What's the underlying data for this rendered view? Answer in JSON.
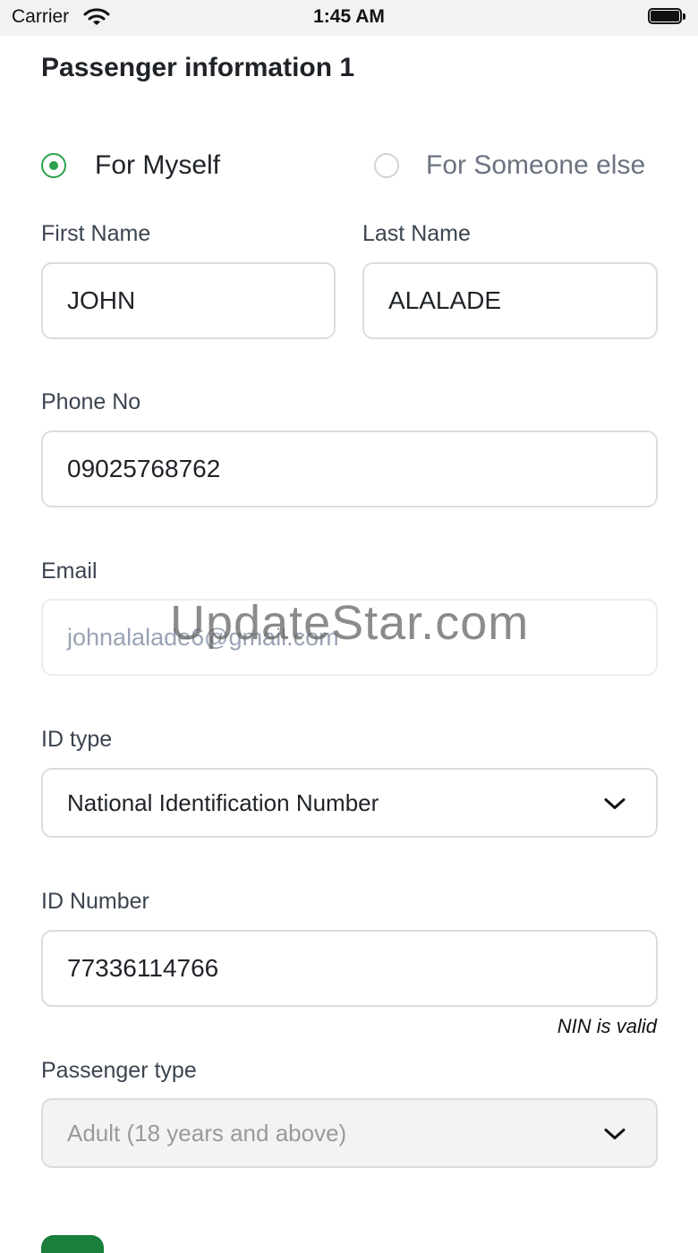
{
  "status_bar": {
    "carrier": "Carrier",
    "time": "1:45 AM"
  },
  "page": {
    "title": "Passenger information 1"
  },
  "booking_for": {
    "options": [
      {
        "label": "For Myself",
        "selected": true
      },
      {
        "label": "For Someone else",
        "selected": false
      }
    ]
  },
  "form": {
    "first_name": {
      "label": "First Name",
      "value": "JOHN"
    },
    "last_name": {
      "label": "Last Name",
      "value": "ALALADE"
    },
    "phone": {
      "label": "Phone No",
      "value": "09025768762"
    },
    "email": {
      "label": "Email",
      "value": "johnalalade6@gmail.com"
    },
    "id_type": {
      "label": "ID type",
      "value": "National Identification Number"
    },
    "id_number": {
      "label": "ID Number",
      "value": "77336114766",
      "validation": "NIN is valid"
    },
    "passenger_type": {
      "label": "Passenger type",
      "value": "Adult (18 years and above)"
    }
  },
  "watermark": "UpdateStar.com",
  "colors": {
    "accent": "#2aa24a",
    "primary_button": "#1a7f3c"
  },
  "icons": [
    "wifi-icon",
    "battery-icon",
    "chevron-down-icon"
  ]
}
